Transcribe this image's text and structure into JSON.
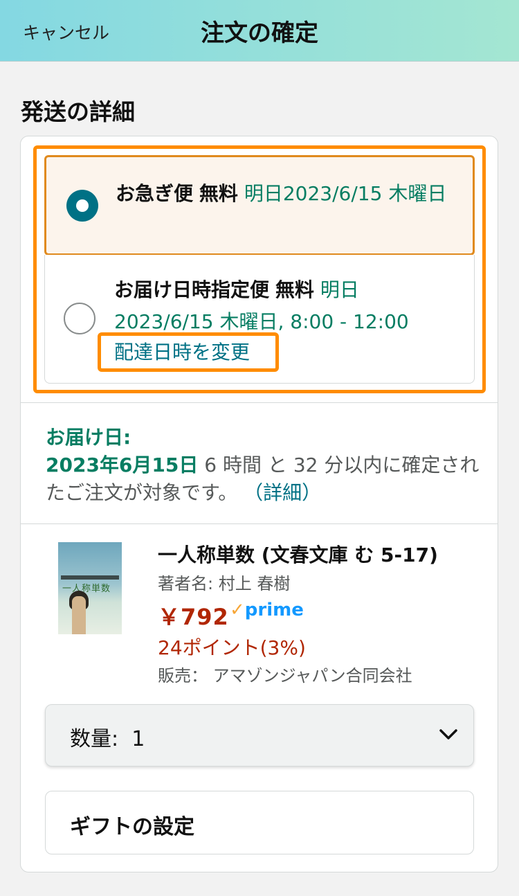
{
  "header": {
    "cancel_label": "キャンセル",
    "title": "注文の確定"
  },
  "shipping": {
    "section_title": "発送の詳細",
    "options": [
      {
        "name": "お急ぎ便",
        "price": "無料",
        "date": "明日2023/6/15 木曜日",
        "selected": true
      },
      {
        "name": "お届け日時指定便",
        "price": "無料",
        "date": "明日 2023/6/15 木曜日, 8:00 - 12:00",
        "selected": false
      }
    ],
    "change_link": "配達日時を変更"
  },
  "delivery": {
    "label": "お届け日:",
    "date": "2023年6月15日",
    "message": "6 時間 と 32 分以内に確定されたご注文が対象です。",
    "details_link": "（詳細）"
  },
  "product": {
    "cover_title": "一人称単数",
    "cover_author": "村上春樹",
    "name": "一人称単数 (文春文庫 む 5-17)",
    "author": "著者名:  村上 春樹",
    "price": "￥792",
    "prime_label": "prime",
    "points": "24ポイント(3%)",
    "seller": "販売：  アマゾンジャパン合同会社"
  },
  "quantity": {
    "label": "数量:",
    "value": "1"
  },
  "gift": {
    "label": "ギフトの設定"
  },
  "colors": {
    "accent_orange": "#ff8c00",
    "link_teal": "#007185",
    "delivery_green": "#067d62",
    "price_red": "#b12704",
    "prime_blue": "#1399ff"
  }
}
